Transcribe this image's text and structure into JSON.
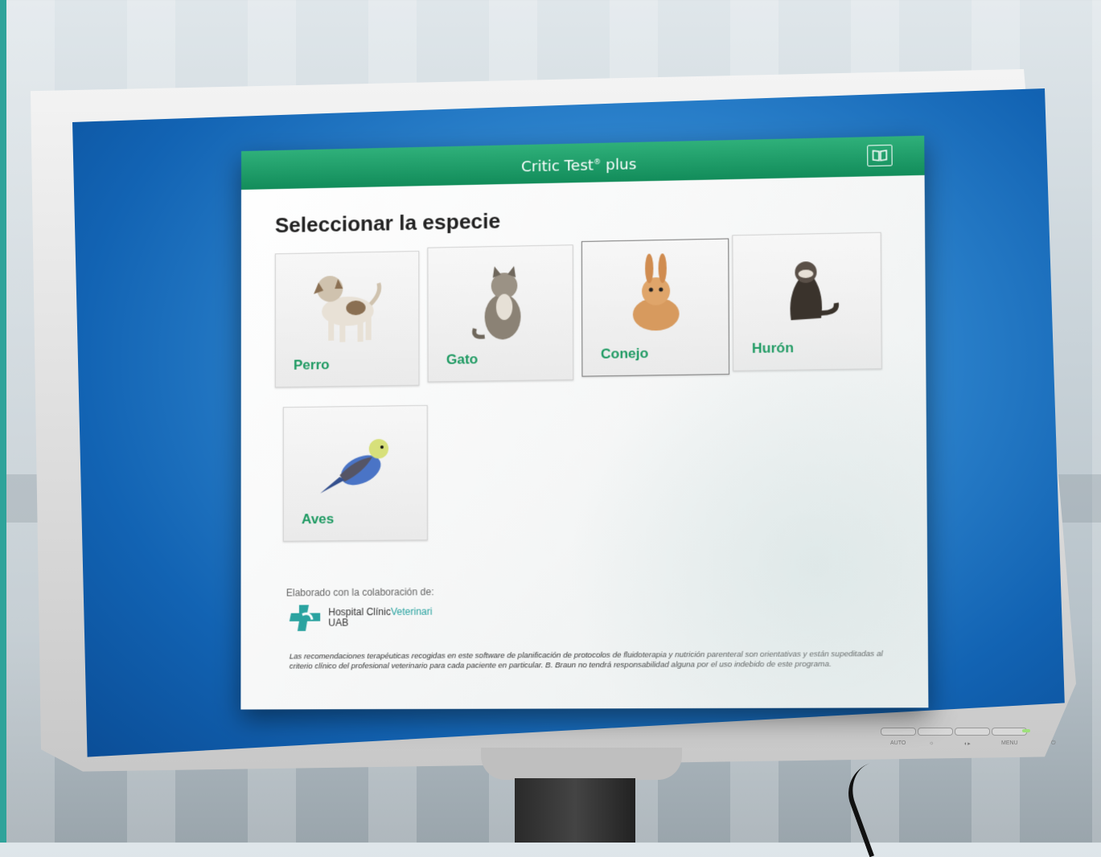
{
  "app": {
    "title": "Critic Test",
    "title_sup": "®",
    "title_suffix": "plus",
    "manual_icon": "book-icon"
  },
  "main": {
    "heading": "Seleccionar la especie",
    "species": [
      {
        "label": "Perro",
        "icon": "dog-icon",
        "selected": false
      },
      {
        "label": "Gato",
        "icon": "cat-icon",
        "selected": false
      },
      {
        "label": "Conejo",
        "icon": "rabbit-icon",
        "selected": true
      },
      {
        "label": "Hurón",
        "icon": "ferret-icon",
        "selected": false
      },
      {
        "label": "Aves",
        "icon": "bird-icon",
        "selected": false
      }
    ]
  },
  "footer": {
    "collab_label": "Elaborado con la colaboración de:",
    "logo_line1_a": "Hospital Clínic",
    "logo_line1_b": "Veterinari",
    "logo_line2": "UAB",
    "disclaimer": "Las recomendaciones terapéuticas recogidas en este software de planificación de protocolos de fluidoterapia y nutrición parenteral son orientativas y están supeditadas al criterio clínico del profesional veterinario para cada paciente en particular. B. Braun no tendrá responsabilidad alguna por el uso indebido de este programa."
  },
  "monitor_buttons": [
    "AUTO",
    "☼",
    "◐▸",
    "MENU",
    "⏻"
  ],
  "colors": {
    "accent_green": "#1e9a62",
    "titlebar": "#128c5a"
  }
}
